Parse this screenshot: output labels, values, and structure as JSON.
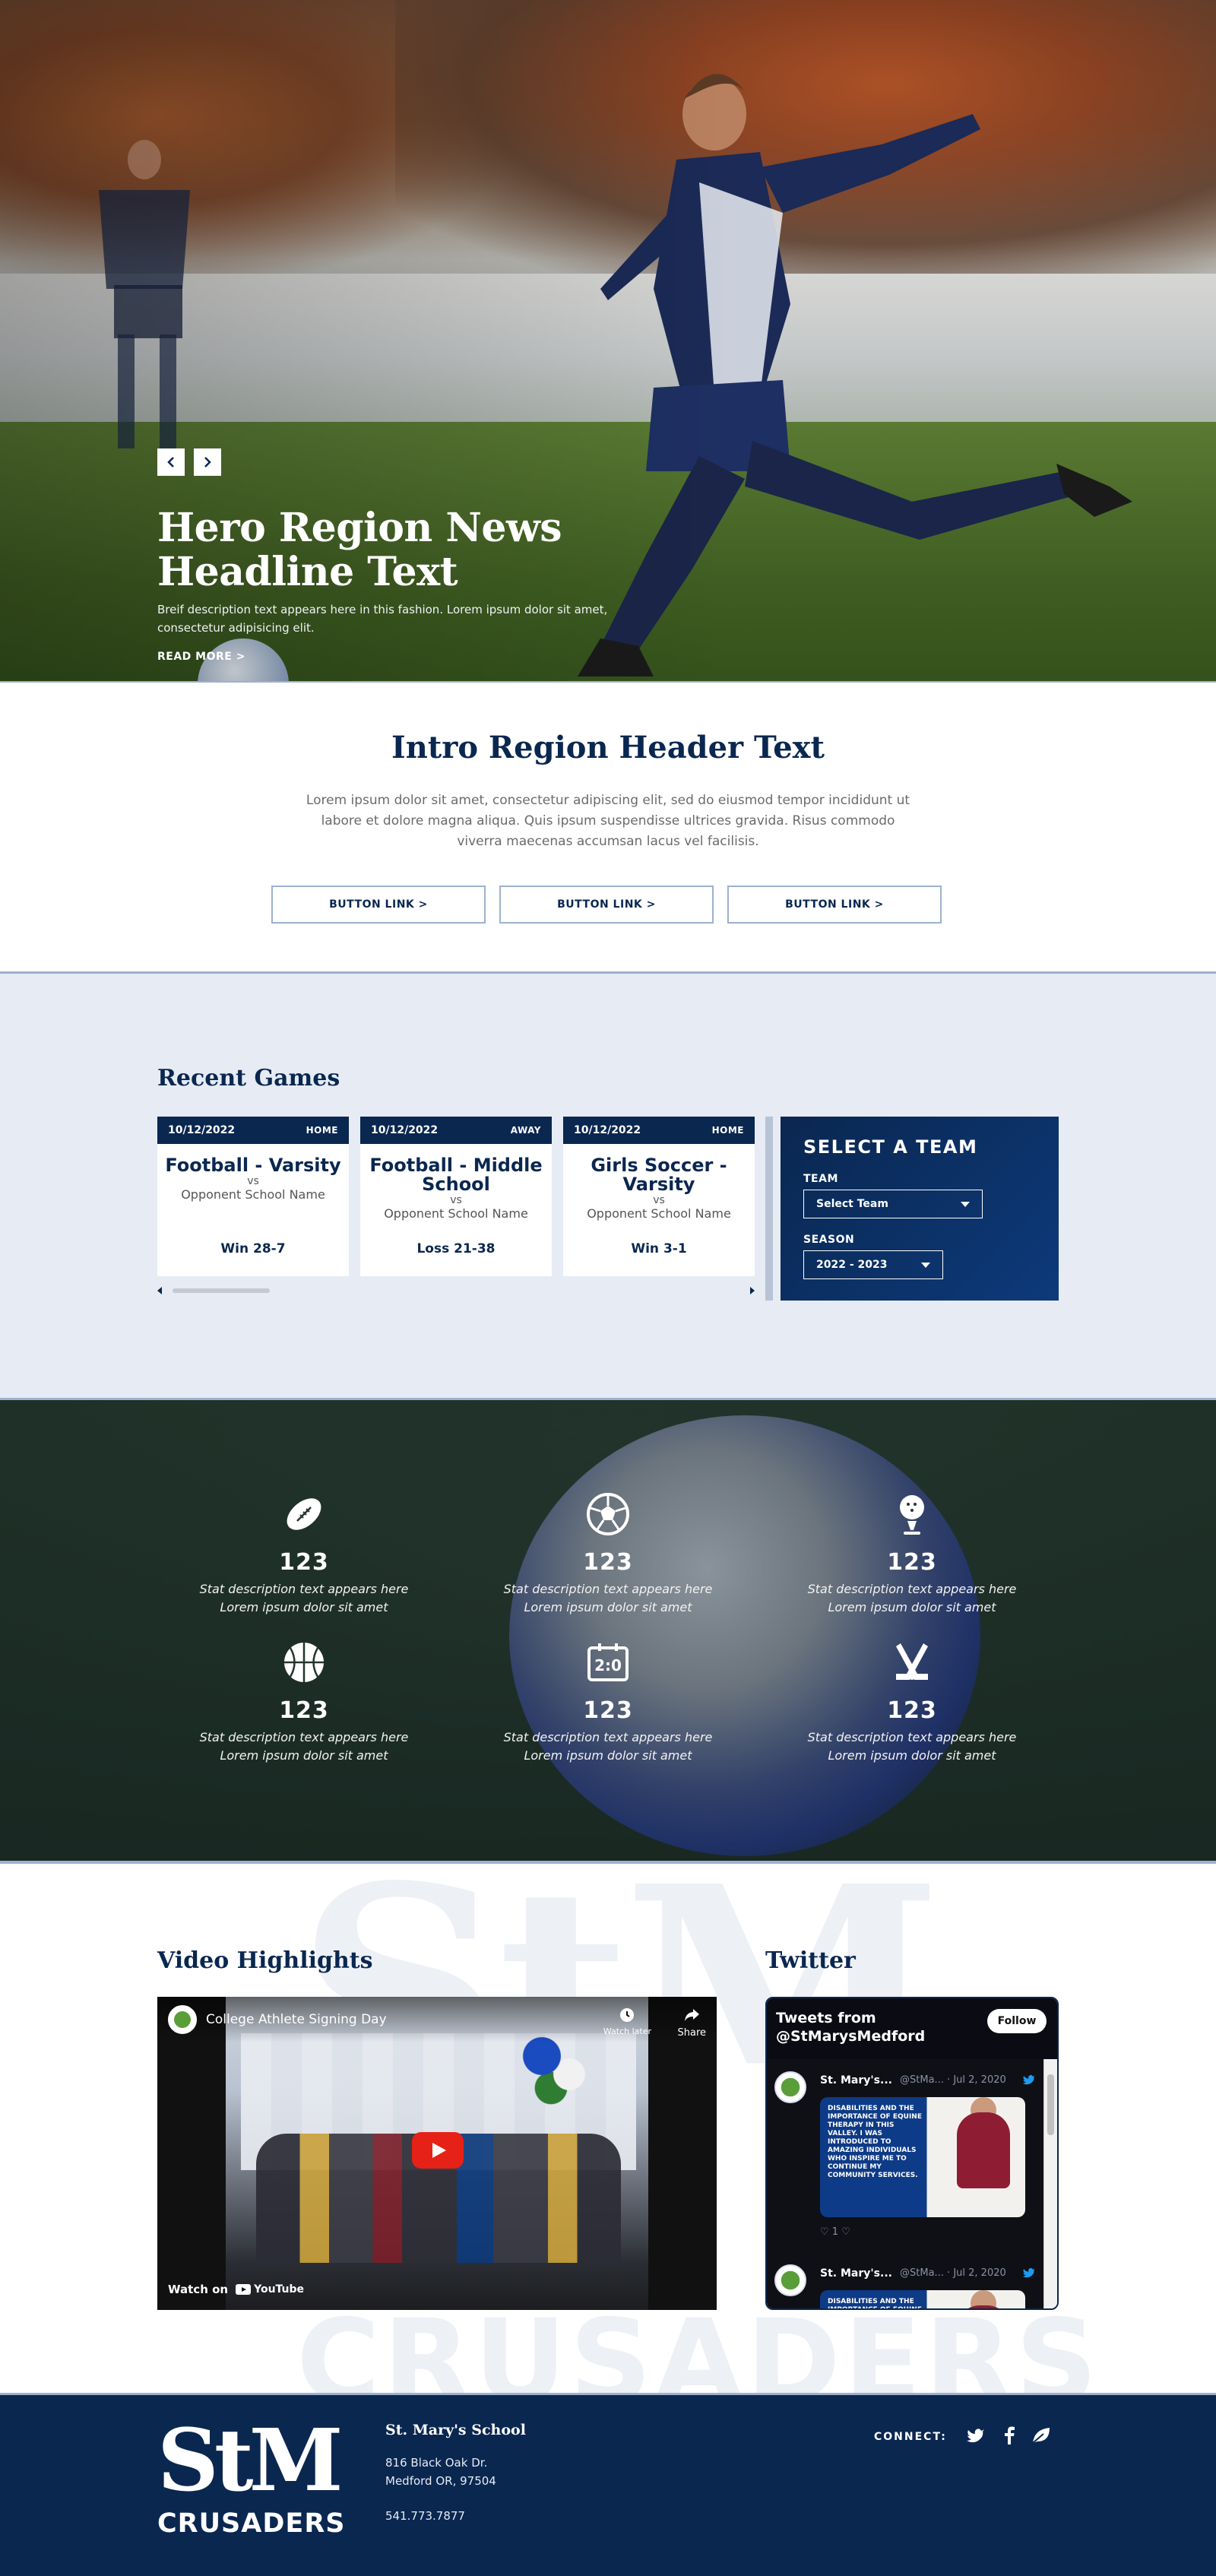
{
  "hero": {
    "title": "Hero Region News Headline Text",
    "description": "Breif description text appears here in this fashion. Lorem ipsum dolor sit amet, consectetur adipisicing elit.",
    "read_more": "READ MORE >",
    "prev_icon": "chevron-left-icon",
    "next_icon": "chevron-right-icon",
    "prev_label": "<",
    "next_label": ">"
  },
  "intro": {
    "title": "Intro Region Header Text",
    "text": "Lorem ipsum dolor sit amet, consectetur adipiscing elit, sed do eiusmod tempor incididunt ut labore et dolore magna aliqua. Quis ipsum suspendisse ultrices gravida. Risus commodo viverra maecenas accumsan lacus vel facilisis.",
    "buttons": [
      "BUTTON LINK >",
      "BUTTON LINK >",
      "BUTTON LINK >"
    ]
  },
  "recent_games": {
    "title": "Recent Games",
    "games": [
      {
        "date": "10/12/2022",
        "location": "HOME",
        "team": "Football - Varsity",
        "vs": "vs",
        "opponent": "Opponent School Name",
        "result": "Win 28-7"
      },
      {
        "date": "10/12/2022",
        "location": "AWAY",
        "team": "Football - Middle School",
        "vs": "vs",
        "opponent": "Opponent School Name",
        "result": "Loss 21-38"
      },
      {
        "date": "10/12/2022",
        "location": "HOME",
        "team": "Girls Soccer - Varsity",
        "vs": "vs",
        "opponent": "Opponent School Name",
        "result": "Win 3-1"
      }
    ],
    "select_team": {
      "title": "SELECT A TEAM",
      "team_label": "TEAM",
      "team_value": "Select Team",
      "season_label": "SEASON",
      "season_value": "2022 - 2023"
    }
  },
  "stats": [
    {
      "icon": "football-icon",
      "number": "123",
      "desc_line1": "Stat description text appears here",
      "desc_line2": "Lorem ipsum dolor sit amet"
    },
    {
      "icon": "soccer-ball-icon",
      "number": "123",
      "desc_line1": "Stat description text appears here",
      "desc_line2": "Lorem ipsum dolor sit amet"
    },
    {
      "icon": "golf-icon",
      "number": "123",
      "desc_line1": "Stat description text appears here",
      "desc_line2": "Lorem ipsum dolor sit amet"
    },
    {
      "icon": "basketball-icon",
      "number": "123",
      "desc_line1": "Stat description text appears here",
      "desc_line2": "Lorem ipsum dolor sit amet"
    },
    {
      "icon": "scoreboard-icon",
      "number": "123",
      "desc_line1": "Stat description text appears here",
      "desc_line2": "Lorem ipsum dolor sit amet",
      "scoreboard_text": "2:0"
    },
    {
      "icon": "hockey-sticks-icon",
      "number": "123",
      "desc_line1": "Stat description text appears here",
      "desc_line2": "Lorem ipsum dolor sit amet"
    }
  ],
  "media": {
    "video_title": "Video Highlights",
    "twitter_title": "Twitter",
    "watermark_top": "StM",
    "watermark_bottom": "CRUSADERS",
    "video": {
      "caption": "College Athlete Signing Day",
      "share": "Share",
      "watch_later": "Watch later",
      "watch_on": "Watch on",
      "youtube": "YouTube"
    },
    "twitter": {
      "header": "Tweets from @StMarysMedford",
      "follow": "Follow",
      "tweets": [
        {
          "name": "St. Mary's...",
          "handle": "@StMa... · Jul 2, 2020",
          "image_text": "DISABILITIES AND THE IMPORTANCE OF EQUINE THERAPY IN THIS VALLEY. I WAS INTRODUCED TO AMAZING INDIVIDUALS WHO INSPIRE ME TO CONTINUE MY COMMUNITY SERVICES.",
          "actions": "♡ 1   ♡"
        },
        {
          "name": "St. Mary's...",
          "handle": "@StMa... · Jul 2, 2020",
          "image_text": "DISABILITIES AND THE IMPORTANCE OF EQUINE THERAPY IN THIS VALLEY. I WAS",
          "actions": ""
        }
      ]
    }
  },
  "footer": {
    "logo_top": "StM",
    "logo_bottom": "CRUSADERS",
    "school_name": "St. Mary's School",
    "address_line1": "816 Black Oak Dr.",
    "address_line2": "Medford OR, 97504",
    "phone": "541.773.7877",
    "connect": "CONNECT:",
    "social": [
      "twitter-icon",
      "facebook-icon",
      "leaf-icon"
    ]
  },
  "colors": {
    "navy": "#0a2750",
    "light_blue": "#9db1cf",
    "bg_light": "#e6ebf4"
  }
}
